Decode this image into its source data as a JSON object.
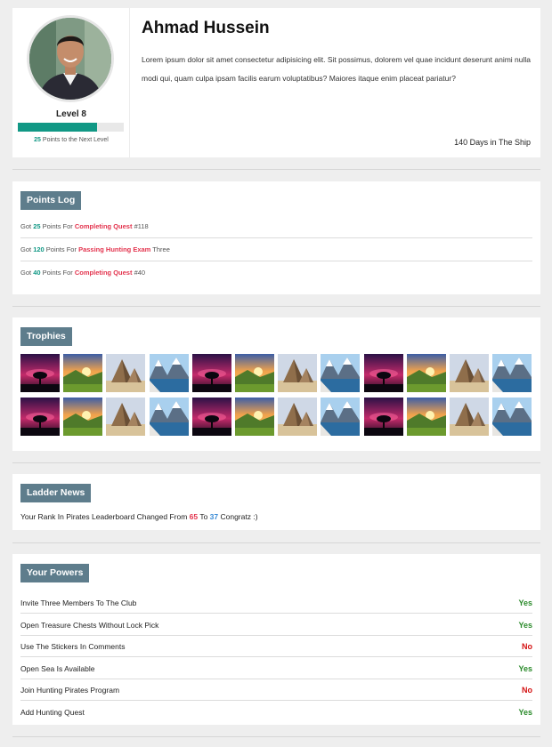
{
  "profile": {
    "name": "Ahmad Hussein",
    "bio": "Lorem ipsum dolor sit amet consectetur adipisicing elit. Sit possimus, dolorem vel quae incidunt deserunt animi nulla modi qui, quam culpa ipsam facilis earum voluptatibus? Maiores itaque enim placeat pariatur?",
    "level_label": "Level 8",
    "progress_percent": 75,
    "points_to_next": "25",
    "points_to_next_suffix": " Points to the Next Level",
    "ship_days": "140 Days in The Ship"
  },
  "points_log": {
    "title": "Points Log",
    "entries": [
      {
        "prefix": "Got ",
        "points": "25",
        "mid": " Points For ",
        "action": "Completing Quest",
        "suffix": " #118"
      },
      {
        "prefix": "Got ",
        "points": "120",
        "mid": " Points For ",
        "action": "Passing Hunting Exam",
        "suffix": " Three"
      },
      {
        "prefix": "Got ",
        "points": "40",
        "mid": " Points For ",
        "action": "Completing Quest",
        "suffix": " #40"
      }
    ]
  },
  "trophies": {
    "title": "Trophies",
    "rows": 2,
    "columns": 12,
    "images": [
      "aurora-tree",
      "sunset-field",
      "pyramids",
      "mountain-lake",
      "aurora-tree",
      "sunset-field",
      "pyramids",
      "mountain-lake",
      "aurora-tree",
      "sunset-field",
      "pyramids",
      "mountain-lake",
      "aurora-tree",
      "sunset-field",
      "pyramids",
      "mountain-lake",
      "aurora-tree",
      "sunset-field",
      "pyramids",
      "mountain-lake",
      "aurora-tree",
      "sunset-field",
      "pyramids",
      "mountain-lake"
    ]
  },
  "ladder_news": {
    "title": "Ladder News",
    "text_before": "Your Rank In Pirates Leaderboard Changed From ",
    "from_rank": "65",
    "text_mid": " To ",
    "to_rank": "37",
    "text_after": " Congratz :)"
  },
  "powers": {
    "title": "Your Powers",
    "items": [
      {
        "label": "Invite Three Members To The Club",
        "value": "Yes"
      },
      {
        "label": "Open Treasure Chests Without Lock Pick",
        "value": "Yes"
      },
      {
        "label": "Use The Stickers In Comments",
        "value": "No"
      },
      {
        "label": "Open Sea Is Available",
        "value": "Yes"
      },
      {
        "label": "Join Hunting Pirates Program",
        "value": "No"
      },
      {
        "label": "Add Hunting Quest",
        "value": "Yes"
      }
    ]
  },
  "colors": {
    "accent": "#119885",
    "title_bg": "#5e7d8c",
    "highlight": "#e3344e",
    "yes": "#2a8a2a",
    "no": "#d41111"
  }
}
